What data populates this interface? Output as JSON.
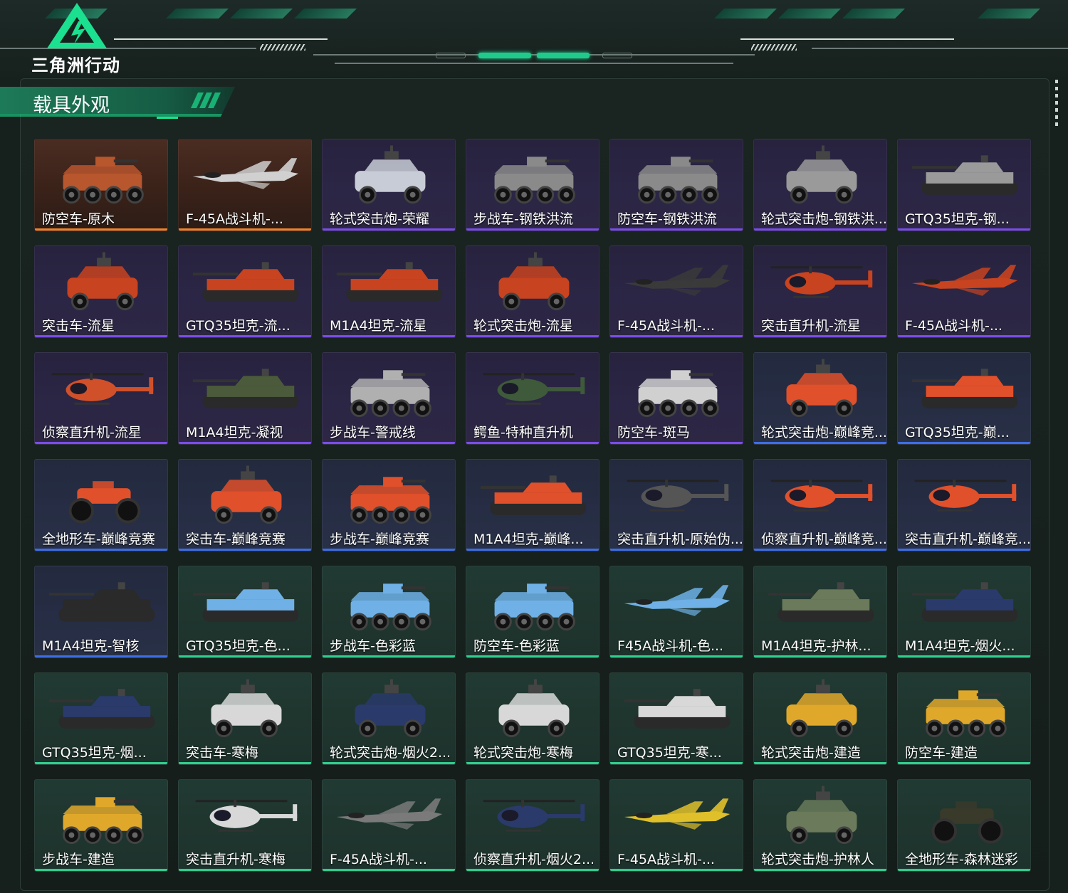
{
  "header": {
    "logo_text": "三角洲行动"
  },
  "section": {
    "title": "载具外观"
  },
  "items": [
    {
      "label": "防空车-原木",
      "rarity": "orange",
      "kind": "wheeled",
      "color": "#b8562e"
    },
    {
      "label": "F-45A战斗机-...",
      "rarity": "orange",
      "kind": "jet",
      "color": "#d0d0d0"
    },
    {
      "label": "轮式突击炮-荣耀",
      "rarity": "purple",
      "kind": "car",
      "color": "#c8ccd6"
    },
    {
      "label": "步战车-钢铁洪流",
      "rarity": "purple",
      "kind": "wheeled",
      "color": "#8a8a8a"
    },
    {
      "label": "防空车-钢铁洪流",
      "rarity": "purple",
      "kind": "wheeled",
      "color": "#8a8a8a"
    },
    {
      "label": "轮式突击炮-钢铁洪...",
      "rarity": "purple",
      "kind": "car",
      "color": "#9a9a9a"
    },
    {
      "label": "GTQ35坦克-钢...",
      "rarity": "purple",
      "kind": "tank",
      "color": "#9a9a9a"
    },
    {
      "label": "突击车-流星",
      "rarity": "purple",
      "kind": "car",
      "color": "#c8431f"
    },
    {
      "label": "GTQ35坦克-流...",
      "rarity": "purple",
      "kind": "tank",
      "color": "#c8431f"
    },
    {
      "label": "M1A4坦克-流星",
      "rarity": "purple",
      "kind": "tank",
      "color": "#c8431f"
    },
    {
      "label": "轮式突击炮-流星",
      "rarity": "purple",
      "kind": "car",
      "color": "#c8431f"
    },
    {
      "label": "F-45A战斗机-...",
      "rarity": "purple",
      "kind": "jet",
      "color": "#3a3a3a"
    },
    {
      "label": "突击直升机-流星",
      "rarity": "purple",
      "kind": "heli",
      "color": "#c8431f"
    },
    {
      "label": "F-45A战斗机-...",
      "rarity": "purple",
      "kind": "jet",
      "color": "#c8431f"
    },
    {
      "label": "侦察直升机-流星",
      "rarity": "purple",
      "kind": "heli",
      "color": "#d0502a"
    },
    {
      "label": "M1A4坦克-凝视",
      "rarity": "purple",
      "kind": "tank",
      "color": "#4a5a3a"
    },
    {
      "label": "步战车-警戒线",
      "rarity": "purple",
      "kind": "wheeled",
      "color": "#b0b0b0"
    },
    {
      "label": "鳄鱼-特种直升机",
      "rarity": "purple",
      "kind": "heli",
      "color": "#3e5a3a"
    },
    {
      "label": "防空车-斑马",
      "rarity": "purple",
      "kind": "wheeled",
      "color": "#d0d0d0"
    },
    {
      "label": "轮式突击炮-巅峰竞...",
      "rarity": "blue",
      "kind": "car",
      "color": "#e0502a"
    },
    {
      "label": "GTQ35坦克-巅...",
      "rarity": "blue",
      "kind": "tank",
      "color": "#e0502a"
    },
    {
      "label": "全地形车-巅峰竞赛",
      "rarity": "blue",
      "kind": "atv",
      "color": "#e0502a"
    },
    {
      "label": "突击车-巅峰竞赛",
      "rarity": "blue",
      "kind": "car",
      "color": "#e0502a"
    },
    {
      "label": "步战车-巅峰竞赛",
      "rarity": "blue",
      "kind": "wheeled",
      "color": "#e0502a"
    },
    {
      "label": "M1A4坦克-巅峰...",
      "rarity": "blue",
      "kind": "tank",
      "color": "#e0502a"
    },
    {
      "label": "突击直升机-原始伪...",
      "rarity": "blue",
      "kind": "heli",
      "color": "#555555"
    },
    {
      "label": "侦察直升机-巅峰竞...",
      "rarity": "blue",
      "kind": "heli",
      "color": "#e0502a"
    },
    {
      "label": "突击直升机-巅峰竞...",
      "rarity": "blue",
      "kind": "heli",
      "color": "#e0502a"
    },
    {
      "label": "M1A4坦克-智核",
      "rarity": "blue",
      "kind": "tank",
      "color": "#2a2a2a"
    },
    {
      "label": "GTQ35坦克-色...",
      "rarity": "green",
      "kind": "tank",
      "color": "#6fb0e6"
    },
    {
      "label": "步战车-色彩蓝",
      "rarity": "green",
      "kind": "wheeled",
      "color": "#6fb0e6"
    },
    {
      "label": "防空车-色彩蓝",
      "rarity": "green",
      "kind": "wheeled",
      "color": "#6fb0e6"
    },
    {
      "label": "F45A战斗机-色...",
      "rarity": "green",
      "kind": "jet",
      "color": "#6fb0e6"
    },
    {
      "label": "M1A4坦克-护林...",
      "rarity": "green",
      "kind": "tank",
      "color": "#6a7a5a"
    },
    {
      "label": "M1A4坦克-烟火...",
      "rarity": "green",
      "kind": "tank",
      "color": "#2a3a6a"
    },
    {
      "label": "GTQ35坦克-烟...",
      "rarity": "green",
      "kind": "tank",
      "color": "#2a3a6a"
    },
    {
      "label": "突击车-寒梅",
      "rarity": "green",
      "kind": "car",
      "color": "#d8d8d8"
    },
    {
      "label": "轮式突击炮-烟火2...",
      "rarity": "green",
      "kind": "car",
      "color": "#2a3a6a"
    },
    {
      "label": "轮式突击炮-寒梅",
      "rarity": "green",
      "kind": "car",
      "color": "#d8d8d8"
    },
    {
      "label": "GTQ35坦克-寒...",
      "rarity": "green",
      "kind": "tank",
      "color": "#d8d8d8"
    },
    {
      "label": "轮式突击炮-建造",
      "rarity": "green",
      "kind": "car",
      "color": "#e0a82a"
    },
    {
      "label": "防空车-建造",
      "rarity": "green",
      "kind": "wheeled",
      "color": "#e0a82a"
    },
    {
      "label": "步战车-建造",
      "rarity": "green",
      "kind": "wheeled",
      "color": "#e0a82a"
    },
    {
      "label": "突击直升机-寒梅",
      "rarity": "green",
      "kind": "heli",
      "color": "#d8d8d8"
    },
    {
      "label": "F-45A战斗机-...",
      "rarity": "green",
      "kind": "jet",
      "color": "#7a7a7a"
    },
    {
      "label": "侦察直升机-烟火2...",
      "rarity": "green",
      "kind": "heli",
      "color": "#2a3a6a"
    },
    {
      "label": "F-45A战斗机-...",
      "rarity": "green",
      "kind": "jet",
      "color": "#e0c02a"
    },
    {
      "label": "轮式突击炮-护林人",
      "rarity": "green",
      "kind": "car",
      "color": "#6a7a5a"
    },
    {
      "label": "全地形车-森林迷彩",
      "rarity": "green",
      "kind": "atv",
      "color": "#3a3a2a"
    }
  ]
}
